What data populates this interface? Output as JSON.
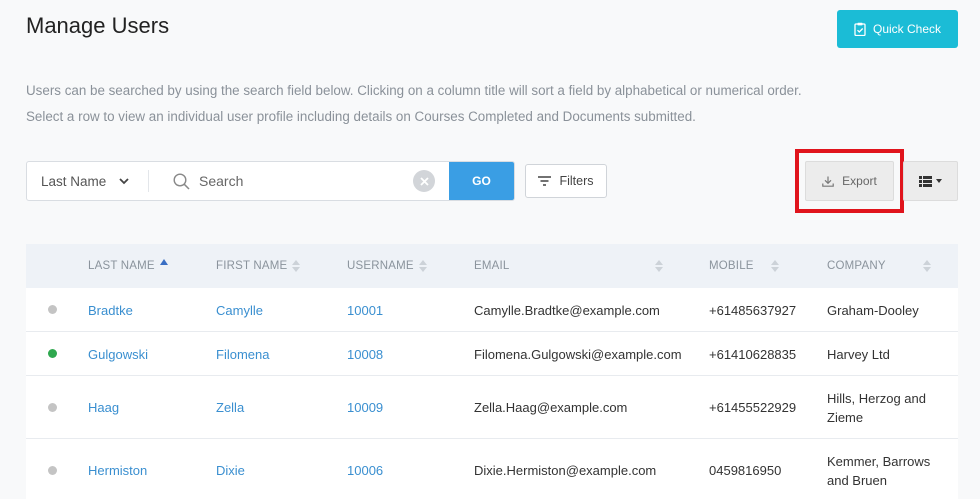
{
  "page": {
    "title": "Manage Users",
    "intro_line1": "Users can be searched by using the search field below. Clicking on a column title will sort a field by alphabetical or numerical order.",
    "intro_line2": "Select a row to view an individual user profile including details on Courses Completed and Documents submitted."
  },
  "toolbar": {
    "quick_check_label": "Quick Check",
    "field_select_value": "Last Name",
    "search_placeholder": "Search",
    "go_label": "GO",
    "filters_label": "Filters",
    "export_label": "Export"
  },
  "colors": {
    "accent": "#1bbcd6",
    "go": "#3a9ee4",
    "link": "#3a8fd0",
    "highlight": "#e0141c",
    "status_active": "#2fa84f",
    "status_inactive": "#c4c4c4"
  },
  "table": {
    "columns": [
      {
        "label": "LAST NAME",
        "sort": "asc"
      },
      {
        "label": "FIRST NAME",
        "sort": "none"
      },
      {
        "label": "USERNAME",
        "sort": "none"
      },
      {
        "label": "EMAIL",
        "sort": "none"
      },
      {
        "label": "MOBILE",
        "sort": "none"
      },
      {
        "label": "COMPANY",
        "sort": "none"
      }
    ],
    "rows": [
      {
        "status": "inactive",
        "last_name": "Bradtke",
        "first_name": "Camylle",
        "username": "10001",
        "email": "Camylle.Bradtke@example.com",
        "mobile": "+61485637927",
        "company_line1": "Graham-Dooley",
        "company_line2": ""
      },
      {
        "status": "active",
        "last_name": "Gulgowski",
        "first_name": "Filomena",
        "username": "10008",
        "email": "Filomena.Gulgowski@example.com",
        "mobile": "+61410628835",
        "company_line1": "Harvey Ltd",
        "company_line2": ""
      },
      {
        "status": "inactive",
        "last_name": "Haag",
        "first_name": "Zella",
        "username": "10009",
        "email": "Zella.Haag@example.com",
        "mobile": "+61455522929",
        "company_line1": "Hills, Herzog and",
        "company_line2": "Zieme"
      },
      {
        "status": "inactive",
        "last_name": "Hermiston",
        "first_name": "Dixie",
        "username": "10006",
        "email": "Dixie.Hermiston@example.com",
        "mobile": "0459816950",
        "company_line1": "Kemmer, Barrows",
        "company_line2": "and Bruen"
      }
    ]
  }
}
